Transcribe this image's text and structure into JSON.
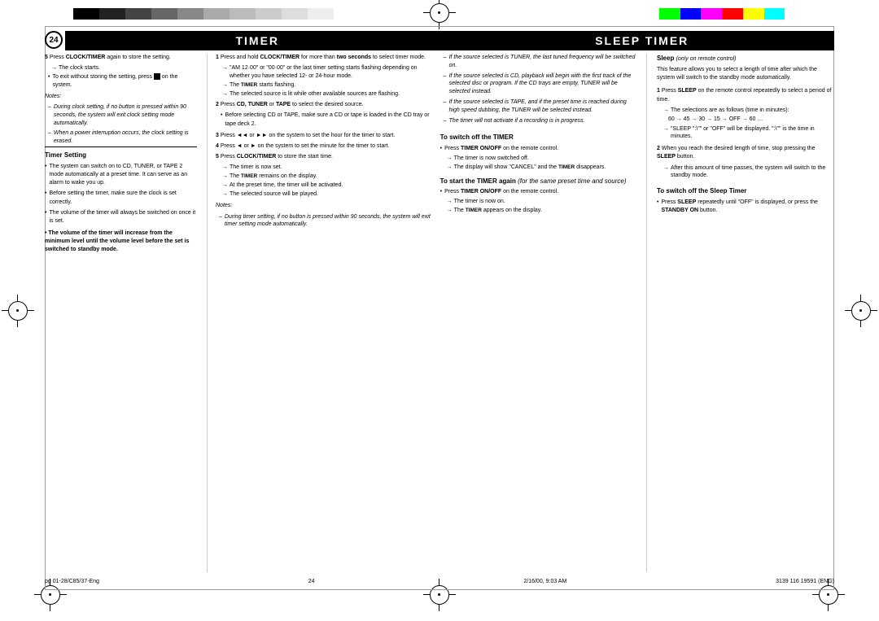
{
  "page": {
    "number": "24",
    "footer_left": "pg 01-28/C85/37-Eng",
    "footer_center": "24",
    "footer_date": "2/16/00, 9:03 AM",
    "footer_right": "3139 116 19591 (ENG)"
  },
  "titles": {
    "timer": "TIMER",
    "sleep_timer": "SLEEP TIMER"
  },
  "col_left": {
    "step5_label": "5",
    "step5_a": "Press ",
    "step5_a_bold": "CLOCK/TIMER",
    "step5_a2": " again to store the setting.",
    "step5_arrow1": "→ The clock starts.",
    "step5_bullet1": "To exit without storing the setting, press",
    "step5_bullet1b": " on the system.",
    "notes_heading": "Notes:",
    "notes": [
      "During clock setting, if no button is pressed within 90 seconds, the system will exit clock setting mode automatically.",
      "When a power interruption occurs, the clock setting is erased."
    ],
    "timer_setting_heading": "Timer Setting",
    "timer_setting_bullets": [
      "The system can switch on to CD, TUNER, or TAPE 2 mode automatically at a preset time. It can serve as an alarm to wake you up.",
      "Before setting the timer, make sure the clock is set correctly.",
      "The volume of the timer will always be switched on once it is set."
    ],
    "warning": "The volume of the timer will increase from the minimum level until the volume level before the set is switched to standby mode."
  },
  "col_middle": {
    "step1_label": "1",
    "step1_text1": "Press and hold ",
    "step1_bold1": "CLOCK/TIMER",
    "step1_text2": " for more than ",
    "step1_bold2": "two seconds",
    "step1_text3": " to select timer mode.",
    "step1_arrow1": "→ \"AM  12·00\" or \"00·00\" or the last timer setting starts flashing depending on whether you have selected 12- or 24-hour mode.",
    "step1_arrow2": "→ The TIMER starts flashing.",
    "step1_arrow3": "→ The selected source is lit while other available sources are flashing.",
    "step2_label": "2",
    "step2_text": "Press ",
    "step2_bold": "CD, TUNER",
    "step2_text2": " or ",
    "step2_bold2": "TAPE",
    "step2_text3": " to select the desired source.",
    "step2_bullet1": "Before selecting CD or TAPE, make sure a CD or tape is loaded in the CD tray or tape deck 2.",
    "step3_label": "3",
    "step3_text": "Press",
    "step3_bold1": "◄◄",
    "step3_or": " or ",
    "step3_bold2": "►►",
    "step3_text2": " on the system to set the hour for the timer to start.",
    "step4_label": "4",
    "step4_text": "Press",
    "step4_bold1": "◄",
    "step4_or": " or ",
    "step4_bold2": "►",
    "step4_text2": " on the system to set the minute for the timer to start.",
    "step5_label": "5",
    "step5_text": "Press ",
    "step5_bold": "CLOCK/TIMER",
    "step5_text2": " to store the start time.",
    "step5_arrow1": "→ The timer is now set.",
    "step5_arrow2": "→ The TIMER remains on the display.",
    "step5_arrow3": "→ At the preset time, the timer will be activated.",
    "step5_arrow4": "→ The selected source will be played.",
    "notes_heading": "Notes:",
    "notes": [
      "During timer setting, if no button is pressed within 90 seconds, the system will exit timer setting mode automatically."
    ],
    "right_col1": [
      "If the source selected is TUNER, the last tuned frequency will be switched on.",
      "If the source selected is CD, playback will begin with the first track of the selected disc or program. If the CD trays are empty, TUNER will be selected instead.",
      "If the source selected is TAPE, and if the preset time is reached during high speed dubbing, the TUNER will be selected instead.",
      "The timer will not activate if a recording is in progress."
    ],
    "switch_off_heading": "To switch off the TIMER",
    "switch_off_bullets": [
      "Press TIMER ON/OFF on the remote control."
    ],
    "switch_off_arrows": [
      "→ The timer is now switched off.",
      "→ The display will show \"CANCEL\" and the TIMER disappears."
    ],
    "start_again_heading": "To start the TIMER again",
    "start_again_sub": "(for the same preset time and source)",
    "start_again_bullets": [
      "Press TIMER ON/OFF on the remote control."
    ],
    "start_again_arrows": [
      "→ The timer is now on.",
      "→ The TIMER appears on the display."
    ]
  },
  "col_right": {
    "sleep_heading": "Sleep",
    "sleep_sub": "(only on remote control)",
    "sleep_intro": "This feature allows you to select a length of time after which the system will switch to the standby mode automatically.",
    "step1_label": "1",
    "step1_text": "Press ",
    "step1_bold": "SLEEP",
    "step1_text2": " on the remote control repeatedly to select a period of time.",
    "step1_arrow": "→ The selections are as follows (time in minutes):",
    "step1_sequence": "60 → 45 → 30 → 15 → OFF → 60 …",
    "step1_arrow2": "→ \"SLEEP \":\"\" or \"OFF\" will be displayed. \":\"\" is the time in minutes.",
    "step2_label": "2",
    "step2_text": "When you reach the desired length of time, stop pressing the ",
    "step2_bold": "SLEEP",
    "step2_text2": " button.",
    "step2_arrow": "→ After this amount of time passes, the system will switch to the standby mode.",
    "switch_off_heading": "To switch off the Sleep Timer",
    "switch_off_bullets": [
      "Press SLEEP repeatedly until \"OFF\" is displayed, or press the"
    ],
    "standby_on": "STANDBY ON",
    "standby_on_suffix": " button."
  }
}
